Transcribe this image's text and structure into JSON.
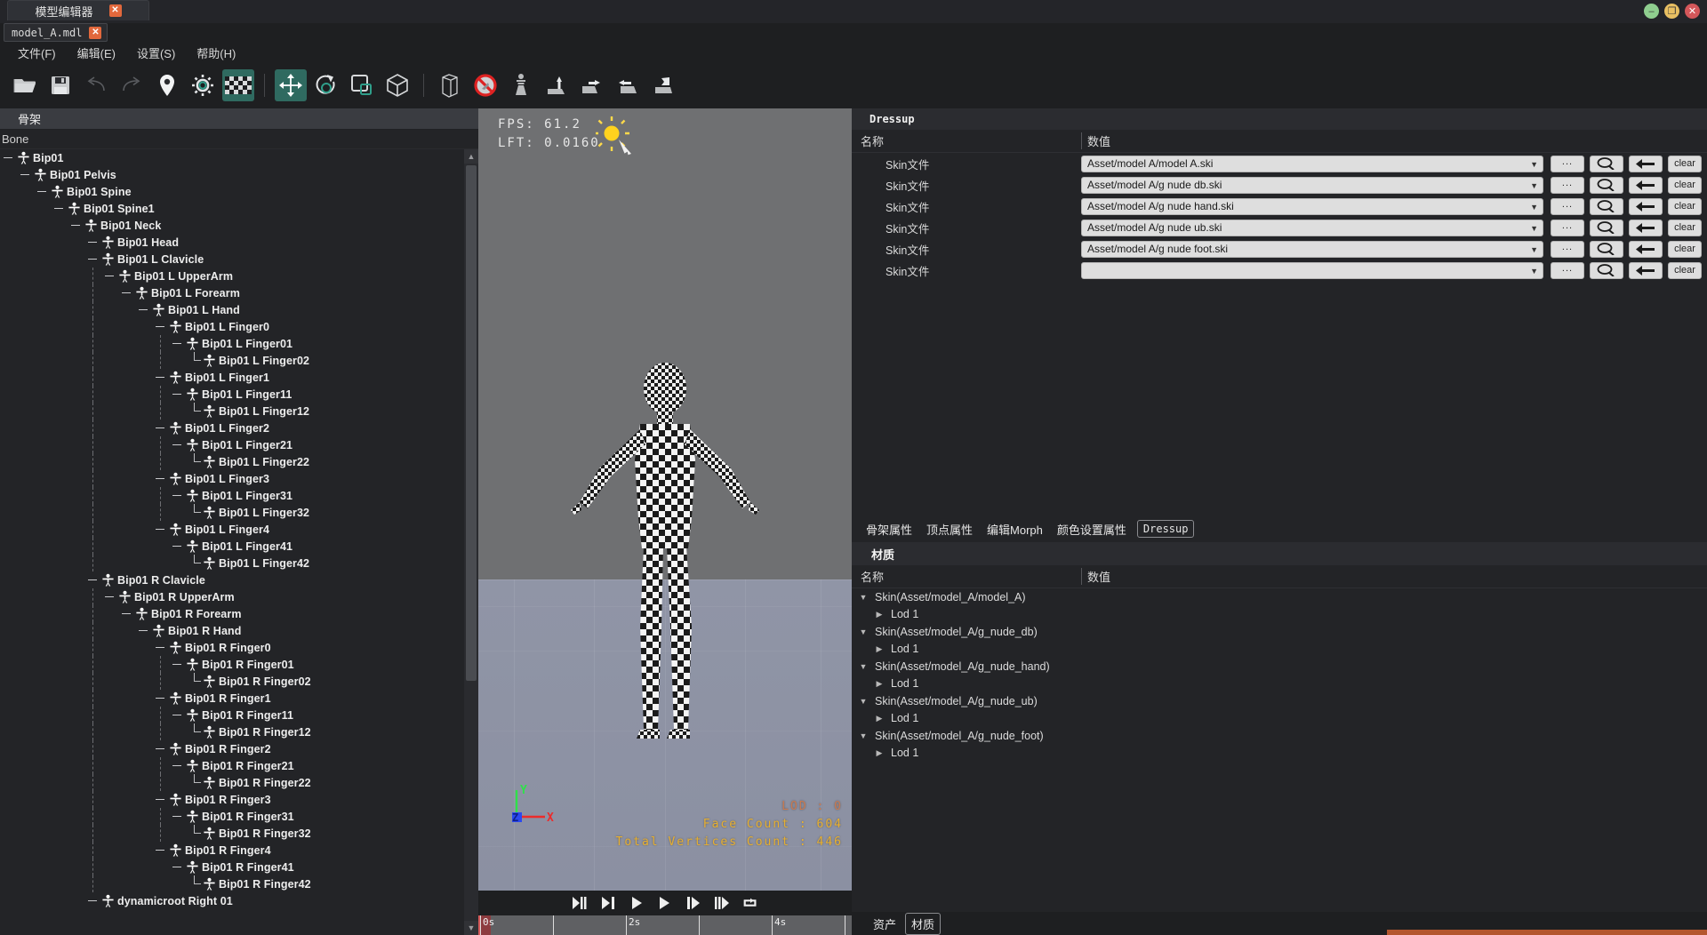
{
  "window": {
    "title": "模型编辑器",
    "close_glyph": "✕",
    "controls": {
      "minimize": "–",
      "maximize": "❐",
      "close": "✕"
    }
  },
  "doc_tab": {
    "name": "model_A.mdl",
    "close_glyph": "✕"
  },
  "menubar": {
    "items": [
      "文件(F)",
      "编辑(E)",
      "设置(S)",
      "帮助(H)"
    ]
  },
  "toolbar": {
    "items": [
      {
        "name": "open-folder-icon",
        "label": "打开"
      },
      {
        "name": "save-icon",
        "label": "保存"
      },
      {
        "name": "undo-icon",
        "label": "撤销"
      },
      {
        "name": "redo-icon",
        "label": "重做"
      },
      {
        "name": "pin-marker-icon",
        "label": "定位"
      },
      {
        "name": "gear-icon",
        "label": "设置"
      },
      {
        "name": "checker-texture-icon",
        "label": "棋盘格",
        "active": true
      },
      {
        "name": "move-gizmo-icon",
        "label": "移动",
        "active": true
      },
      {
        "name": "rotate-gizmo-icon",
        "label": "旋转"
      },
      {
        "name": "scale-gizmo-icon",
        "label": "缩放"
      },
      {
        "name": "cube-icon",
        "label": "模型"
      },
      {
        "name": "bounding-box-icon",
        "label": "包围盒"
      },
      {
        "name": "no-entry-icon",
        "label": "禁用"
      },
      {
        "name": "pawn-icon",
        "label": "角色"
      },
      {
        "name": "pose-a-icon",
        "label": "姿势A"
      },
      {
        "name": "pose-b-icon",
        "label": "姿势B"
      },
      {
        "name": "pose-c-icon",
        "label": "姿势C"
      },
      {
        "name": "pose-d-icon",
        "label": "姿势D"
      }
    ]
  },
  "skeleton": {
    "panel_title": "骨架",
    "column_header": "Bone",
    "nodes": [
      {
        "depth": 0,
        "label": "Bip01"
      },
      {
        "depth": 1,
        "label": "Bip01 Pelvis"
      },
      {
        "depth": 2,
        "label": "Bip01 Spine"
      },
      {
        "depth": 3,
        "label": "Bip01 Spine1"
      },
      {
        "depth": 4,
        "label": "Bip01 Neck"
      },
      {
        "depth": 5,
        "label": "Bip01 Head"
      },
      {
        "depth": 5,
        "label": "Bip01 L Clavicle"
      },
      {
        "depth": 6,
        "label": "Bip01 L UpperArm"
      },
      {
        "depth": 7,
        "label": "Bip01 L Forearm"
      },
      {
        "depth": 8,
        "label": "Bip01 L Hand"
      },
      {
        "depth": 9,
        "label": "Bip01 L Finger0"
      },
      {
        "depth": 10,
        "label": "Bip01 L Finger01"
      },
      {
        "depth": 11,
        "label": "Bip01 L Finger02",
        "last": true
      },
      {
        "depth": 9,
        "label": "Bip01 L Finger1"
      },
      {
        "depth": 10,
        "label": "Bip01 L Finger11"
      },
      {
        "depth": 11,
        "label": "Bip01 L Finger12",
        "last": true
      },
      {
        "depth": 9,
        "label": "Bip01 L Finger2"
      },
      {
        "depth": 10,
        "label": "Bip01 L Finger21"
      },
      {
        "depth": 11,
        "label": "Bip01 L Finger22",
        "last": true
      },
      {
        "depth": 9,
        "label": "Bip01 L Finger3"
      },
      {
        "depth": 10,
        "label": "Bip01 L Finger31"
      },
      {
        "depth": 11,
        "label": "Bip01 L Finger32",
        "last": true
      },
      {
        "depth": 9,
        "label": "Bip01 L Finger4"
      },
      {
        "depth": 10,
        "label": "Bip01 L Finger41"
      },
      {
        "depth": 11,
        "label": "Bip01 L Finger42",
        "last": true
      },
      {
        "depth": 5,
        "label": "Bip01 R Clavicle"
      },
      {
        "depth": 6,
        "label": "Bip01 R UpperArm"
      },
      {
        "depth": 7,
        "label": "Bip01 R Forearm"
      },
      {
        "depth": 8,
        "label": "Bip01 R Hand"
      },
      {
        "depth": 9,
        "label": "Bip01 R Finger0"
      },
      {
        "depth": 10,
        "label": "Bip01 R Finger01"
      },
      {
        "depth": 11,
        "label": "Bip01 R Finger02",
        "last": true
      },
      {
        "depth": 9,
        "label": "Bip01 R Finger1"
      },
      {
        "depth": 10,
        "label": "Bip01 R Finger11"
      },
      {
        "depth": 11,
        "label": "Bip01 R Finger12",
        "last": true
      },
      {
        "depth": 9,
        "label": "Bip01 R Finger2"
      },
      {
        "depth": 10,
        "label": "Bip01 R Finger21"
      },
      {
        "depth": 11,
        "label": "Bip01 R Finger22",
        "last": true
      },
      {
        "depth": 9,
        "label": "Bip01 R Finger3"
      },
      {
        "depth": 10,
        "label": "Bip01 R Finger31"
      },
      {
        "depth": 11,
        "label": "Bip01 R Finger32",
        "last": true
      },
      {
        "depth": 9,
        "label": "Bip01 R Finger4"
      },
      {
        "depth": 10,
        "label": "Bip01 R Finger41"
      },
      {
        "depth": 11,
        "label": "Bip01 R Finger42",
        "last": true
      },
      {
        "depth": 5,
        "label": "dynamicroot Right 01"
      }
    ]
  },
  "viewport": {
    "fps_label": "FPS:",
    "fps_value": "61.2",
    "lft_label": "LFT:",
    "lft_value": "0.0160",
    "lod": "LOD : 0",
    "face_count": "Face Count : 604",
    "vertices_count": "Total Vertices Count : 446",
    "axis": {
      "x": "X",
      "y": "Y",
      "z": "Z"
    }
  },
  "transport": {
    "buttons": [
      {
        "name": "step-back-all-button",
        "glyph": "◀|||"
      },
      {
        "name": "step-back-button",
        "glyph": "◀|"
      },
      {
        "name": "play-reverse-button",
        "glyph": "◀"
      },
      {
        "name": "play-button",
        "glyph": "▶"
      },
      {
        "name": "step-forward-button",
        "glyph": "|▶"
      },
      {
        "name": "step-forward-all-button",
        "glyph": "|||▶"
      },
      {
        "name": "loop-button",
        "glyph": "⟳"
      }
    ]
  },
  "timeline": {
    "ticks": [
      {
        "label": "0s",
        "pos": 2
      },
      {
        "label": "",
        "pos": 84
      },
      {
        "label": "2s",
        "pos": 166
      },
      {
        "label": "",
        "pos": 248
      },
      {
        "label": "4s",
        "pos": 330
      },
      {
        "label": "",
        "pos": 412
      }
    ],
    "cursor_position": 0
  },
  "dressup": {
    "panel_title": "Dressup",
    "columns": {
      "name": "名称",
      "value": "数值"
    },
    "rows": [
      {
        "label": "Skin文件",
        "value": "Asset/model A/model A.ski"
      },
      {
        "label": "Skin文件",
        "value": "Asset/model A/g nude db.ski"
      },
      {
        "label": "Skin文件",
        "value": "Asset/model A/g nude hand.ski"
      },
      {
        "label": "Skin文件",
        "value": "Asset/model A/g nude ub.ski"
      },
      {
        "label": "Skin文件",
        "value": "Asset/model A/g nude foot.ski"
      },
      {
        "label": "Skin文件",
        "value": ""
      }
    ],
    "row_buttons": {
      "browse": "...",
      "find": "find-icon",
      "apply": "apply-icon",
      "clear": "clear"
    }
  },
  "property_tabs": {
    "items": [
      "骨架属性",
      "顶点属性",
      "编辑Morph",
      "颜色设置属性",
      "Dressup"
    ],
    "active": "Dressup"
  },
  "material": {
    "panel_title": "材质",
    "columns": {
      "name": "名称",
      "value": "数值"
    },
    "rows": [
      {
        "depth": 0,
        "label": "Skin(Asset/model_A/model_A)",
        "expanded": true
      },
      {
        "depth": 1,
        "label": "Lod 1",
        "expanded": false
      },
      {
        "depth": 0,
        "label": "Skin(Asset/model_A/g_nude_db)",
        "expanded": true
      },
      {
        "depth": 1,
        "label": "Lod 1",
        "expanded": false
      },
      {
        "depth": 0,
        "label": "Skin(Asset/model_A/g_nude_hand)",
        "expanded": true
      },
      {
        "depth": 1,
        "label": "Lod 1",
        "expanded": false
      },
      {
        "depth": 0,
        "label": "Skin(Asset/model_A/g_nude_ub)",
        "expanded": true
      },
      {
        "depth": 1,
        "label": "Lod 1",
        "expanded": false
      },
      {
        "depth": 0,
        "label": "Skin(Asset/model_A/g_nude_foot)",
        "expanded": true
      },
      {
        "depth": 1,
        "label": "Lod 1",
        "expanded": false
      }
    ]
  },
  "bottom_tabs": {
    "items": [
      "资产",
      "材质"
    ],
    "active": "材质"
  },
  "colors": {
    "accent_teal": "#2f6a60",
    "close_orange": "#e2683c",
    "stat_yellow": "#e8b030",
    "lod_orange": "#c97a50",
    "panel_bg": "#232427",
    "viewport_ground": "#9095a6"
  }
}
